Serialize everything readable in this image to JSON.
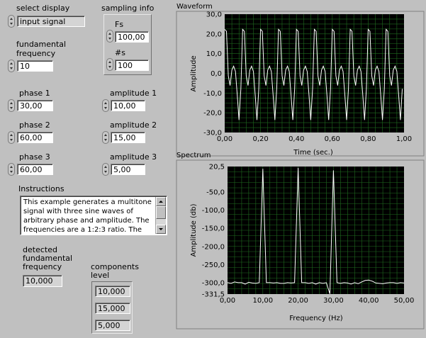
{
  "controls": {
    "select_display": {
      "label": "select display",
      "value": "input signal"
    },
    "fundamental_frequency": {
      "label": "fundamental\nfrequency",
      "label_line1": "fundamental",
      "label_line2": "frequency",
      "value": "10"
    },
    "sampling_info": {
      "label": "sampling info",
      "fs_label": "Fs",
      "fs_value": "100,00",
      "ns_label": "#s",
      "ns_value": "100"
    },
    "phase1": {
      "label": "phase 1",
      "value": "30,00"
    },
    "phase2": {
      "label": "phase 2",
      "value": "60,00"
    },
    "phase3": {
      "label": "phase 3",
      "value": "60,00"
    },
    "amplitude1": {
      "label": "amplitude 1",
      "value": "10,00"
    },
    "amplitude2": {
      "label": "amplitude 2",
      "value": "15,00"
    },
    "amplitude3": {
      "label": "amplitude 3",
      "value": "5,00"
    }
  },
  "instructions": {
    "label": "Instructions",
    "text": "This example generates a multitone signal with three sine waves of arbitrary phase and amplitude.  The frequencies are a 1:2:3 ratio.  The"
  },
  "indicators": {
    "detected_label_line1": "detected",
    "detected_label_line2": "fundamental",
    "detected_label_line3": "frequency",
    "detected_value": "10,000",
    "components_label_line1": "components",
    "components_label_line2": "level",
    "components_values": [
      "10,000",
      "15,000",
      "5,000"
    ]
  },
  "chart_data": [
    {
      "type": "line",
      "title": "Waveform",
      "xlabel": "Time (sec.)",
      "ylabel": "Amplitude",
      "xlim": [
        0,
        1
      ],
      "ylim": [
        -30,
        30
      ],
      "x_ticks": [
        "0,00",
        "0,20",
        "0,40",
        "0,60",
        "0,80",
        "1,00"
      ],
      "y_ticks": [
        "30,0",
        "20,0",
        "10,0",
        "0,0",
        "-10,0",
        "-20,0",
        "-30,0"
      ],
      "grid": true,
      "series": [
        {
          "components": [
            {
              "freq_hz": 10,
              "amplitude": 10,
              "phase_deg": 30
            },
            {
              "freq_hz": 20,
              "amplitude": 15,
              "phase_deg": 60
            },
            {
              "freq_hz": 30,
              "amplitude": 5,
              "phase_deg": 60
            }
          ],
          "sample_rate": 100,
          "samples": 100
        }
      ],
      "colors": {
        "background": "#000000",
        "grid": "#1f6b1f",
        "trace": "#ffffff"
      }
    },
    {
      "type": "line",
      "title": "Spectrum",
      "xlabel": "Frequency (Hz)",
      "ylabel": "Amplitude (db)",
      "xlim": [
        0,
        50
      ],
      "ylim": [
        -331.5,
        20.5
      ],
      "x_ticks": [
        "0,00",
        "10,00",
        "20,00",
        "30,00",
        "40,00",
        "50,00"
      ],
      "y_ticks": [
        "20,5",
        "-50,0",
        "-100,0",
        "-150,0",
        "-200,0",
        "-250,0",
        "-300,0",
        "-331,5"
      ],
      "grid": true,
      "series": [
        {
          "x": [
            0,
            1,
            2,
            3,
            4,
            5,
            6,
            7,
            8,
            9,
            10,
            11,
            12,
            13,
            14,
            15,
            16,
            17,
            18,
            19,
            20,
            21,
            22,
            23,
            24,
            25,
            26,
            27,
            28,
            29,
            30,
            31,
            32,
            33,
            34,
            35,
            36,
            37,
            38,
            39,
            40,
            41,
            42,
            43,
            44,
            45,
            46,
            47,
            48,
            49,
            50
          ],
          "y": [
            -300,
            -302,
            -298,
            -300,
            -300,
            -304,
            -299,
            -301,
            -302,
            -300,
            14,
            -300,
            -300,
            -301,
            -300,
            -302,
            -302,
            -300,
            -301,
            -300,
            17,
            -300,
            -300,
            -302,
            -300,
            -304,
            -300,
            -302,
            -300,
            -331,
            10,
            -300,
            -302,
            -300,
            -301,
            -304,
            -300,
            -303,
            -298,
            -294,
            -293,
            -296,
            -301,
            -302,
            -303,
            -301,
            -300,
            -300,
            -302,
            -300,
            -301
          ]
        }
      ],
      "colors": {
        "background": "#000000",
        "grid": "#1f6b1f",
        "trace": "#ffffff"
      }
    }
  ]
}
